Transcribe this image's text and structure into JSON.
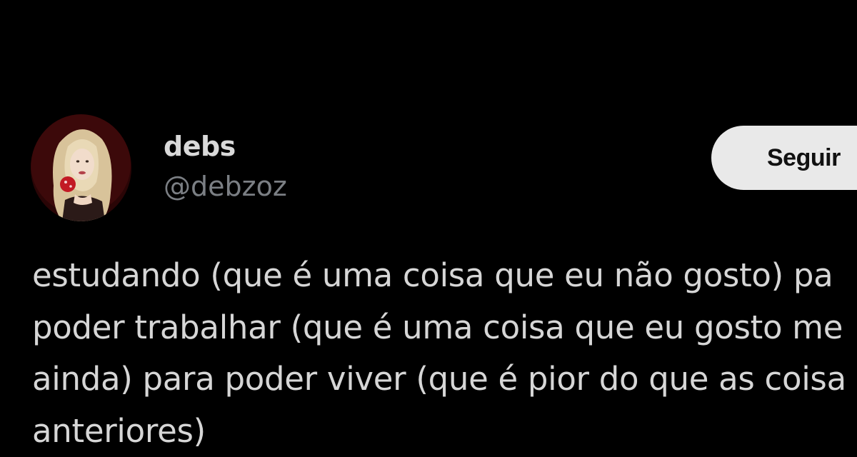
{
  "user": {
    "display_name": "debs",
    "handle": "@debzoz",
    "avatar_icon": "profile-photo-avatar"
  },
  "actions": {
    "follow_label": "Seguir"
  },
  "tweet": {
    "lines": [
      "estudando (que é uma coisa que eu não gosto) pa",
      "poder trabalhar (que é uma coisa que eu gosto me",
      "ainda) para poder viver (que é pior do que as coisa",
      "anteriores)"
    ]
  },
  "colors": {
    "background": "#000000",
    "name_text": "#d9d9d9",
    "handle_text": "#7b7f84",
    "body_text": "#d6d6d6",
    "follow_button_bg": "#e9e9e9",
    "follow_button_text": "#111111"
  }
}
